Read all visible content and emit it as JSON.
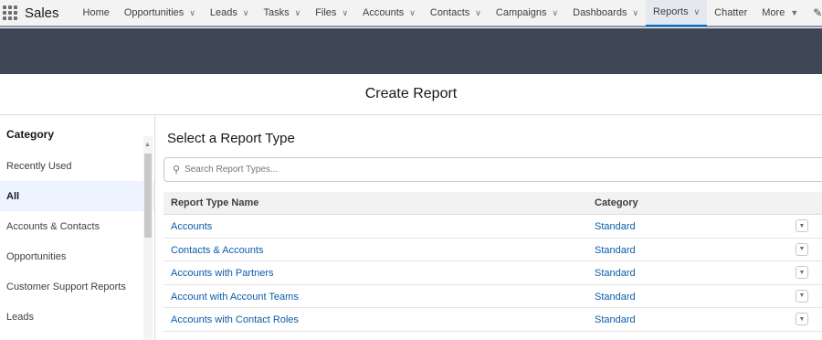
{
  "app": {
    "name": "Sales"
  },
  "nav": {
    "items": [
      {
        "label": "Home",
        "chevron": false,
        "active": false
      },
      {
        "label": "Opportunities",
        "chevron": true,
        "active": false
      },
      {
        "label": "Leads",
        "chevron": true,
        "active": false
      },
      {
        "label": "Tasks",
        "chevron": true,
        "active": false
      },
      {
        "label": "Files",
        "chevron": true,
        "active": false
      },
      {
        "label": "Accounts",
        "chevron": true,
        "active": false
      },
      {
        "label": "Contacts",
        "chevron": true,
        "active": false
      },
      {
        "label": "Campaigns",
        "chevron": true,
        "active": false
      },
      {
        "label": "Dashboards",
        "chevron": true,
        "active": false
      },
      {
        "label": "Reports",
        "chevron": true,
        "active": true
      },
      {
        "label": "Chatter",
        "chevron": false,
        "active": false
      },
      {
        "label": "More",
        "chevron": "▼",
        "active": false
      }
    ]
  },
  "modal": {
    "title": "Create Report"
  },
  "sidebar": {
    "title": "Category",
    "items": [
      {
        "label": "Recently Used",
        "selected": false
      },
      {
        "label": "All",
        "selected": true
      },
      {
        "label": "Accounts & Contacts",
        "selected": false
      },
      {
        "label": "Opportunities",
        "selected": false
      },
      {
        "label": "Customer Support Reports",
        "selected": false
      },
      {
        "label": "Leads",
        "selected": false
      }
    ]
  },
  "main": {
    "title": "Select a Report Type",
    "search": {
      "placeholder": "Search Report Types...",
      "value": ""
    },
    "table": {
      "columns": [
        "Report Type Name",
        "Category"
      ],
      "rows": [
        [
          "Accounts",
          "Standard"
        ],
        [
          "Contacts & Accounts",
          "Standard"
        ],
        [
          "Accounts with Partners",
          "Standard"
        ],
        [
          "Account with Account Teams",
          "Standard"
        ],
        [
          "Accounts with Contact Roles",
          "Standard"
        ]
      ]
    }
  },
  "icons": {
    "app_launcher": "waffle-grid-icon",
    "search": "search-icon",
    "row_menu": "chevron-down-icon",
    "edit": "pencil-icon"
  },
  "colors": {
    "accent": "#0070d2",
    "link": "#0b5cab",
    "band": "#3e4656",
    "selected_bg": "#eef4ff"
  }
}
